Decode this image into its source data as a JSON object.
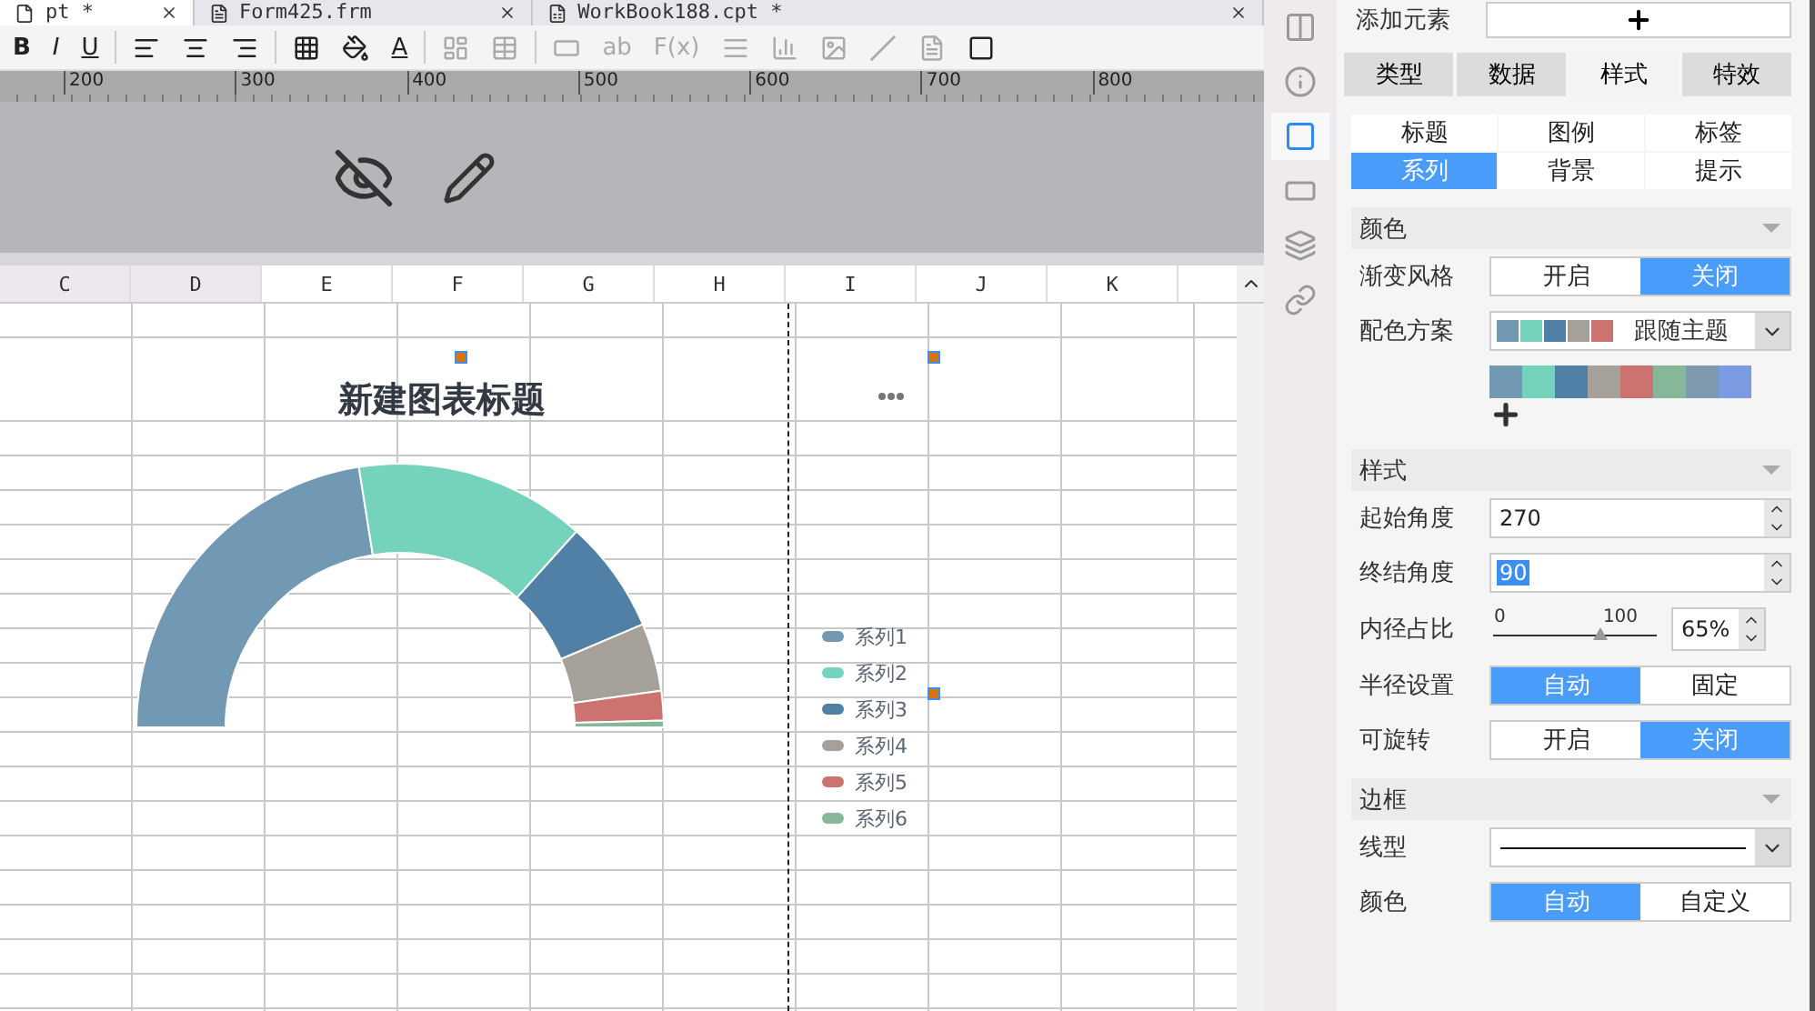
{
  "doc_tabs": [
    {
      "label": "pt *",
      "kind": "plain",
      "selected": true
    },
    {
      "label": "Form425.frm",
      "kind": "form",
      "selected": false
    },
    {
      "label": "WorkBook188.cpt *",
      "kind": "book",
      "selected": false
    }
  ],
  "toolbar": {
    "format_buttons": [
      "B",
      "I",
      "U"
    ],
    "font_color_button": "A",
    "text_tools": [
      "ab",
      "F(x)"
    ]
  },
  "ruler": {
    "ticks": [
      "200",
      "300",
      "400",
      "500",
      "600",
      "700",
      "800"
    ]
  },
  "sheet": {
    "columns": [
      {
        "label": "C",
        "selected": true
      },
      {
        "label": "D",
        "selected": true
      },
      {
        "label": "E",
        "selected": false
      },
      {
        "label": "F",
        "selected": false
      },
      {
        "label": "G",
        "selected": false
      },
      {
        "label": "H",
        "selected": false
      },
      {
        "label": "I",
        "selected": false
      },
      {
        "label": "J",
        "selected": false
      },
      {
        "label": "K",
        "selected": false
      }
    ]
  },
  "chart": {
    "title": "新建图表标题",
    "legend": [
      {
        "label": "系列1",
        "color": "#7299b3"
      },
      {
        "label": "系列2",
        "color": "#75d2bd"
      },
      {
        "label": "系列3",
        "color": "#5080a6"
      },
      {
        "label": "系列4",
        "color": "#a5a19a"
      },
      {
        "label": "系列5",
        "color": "#cc7370"
      },
      {
        "label": "系列6",
        "color": "#85b898"
      }
    ]
  },
  "sidebar": [
    {
      "selected": false
    },
    {
      "selected": false
    },
    {
      "selected": true
    },
    {
      "selected": false
    },
    {
      "selected": false
    },
    {
      "selected": false
    }
  ],
  "panel": {
    "add_element": "添加元素",
    "tabs": [
      {
        "label": "类型",
        "selected": false
      },
      {
        "label": "数据",
        "selected": false
      },
      {
        "label": "样式",
        "selected": true
      },
      {
        "label": "特效",
        "selected": false
      }
    ],
    "sub_tabs": [
      {
        "label": "标题",
        "selected": false
      },
      {
        "label": "图例",
        "selected": false
      },
      {
        "label": "标签",
        "selected": false
      },
      {
        "label": "系列",
        "selected": true
      },
      {
        "label": "背景",
        "selected": false
      },
      {
        "label": "提示",
        "selected": false
      }
    ],
    "rows": [
      {
        "kind": "header",
        "label": "颜色"
      },
      {
        "kind": "toggle",
        "label": "渐变风格",
        "options": [
          {
            "label": "开启",
            "selected": false
          },
          {
            "label": "关闭",
            "selected": true
          }
        ]
      },
      {
        "kind": "scheme",
        "label": "配色方案",
        "value": "跟随主题",
        "swatches": [
          {
            "color": "#7299b3"
          },
          {
            "color": "#75d2bd"
          },
          {
            "color": "#5080a6"
          },
          {
            "color": "#a5a19a"
          },
          {
            "color": "#cc7370"
          }
        ]
      },
      {
        "kind": "palette",
        "swatches": [
          {
            "color": "#7299b3"
          },
          {
            "color": "#75d2bd"
          },
          {
            "color": "#5080a6"
          },
          {
            "color": "#a5a19a"
          },
          {
            "color": "#cc7370"
          },
          {
            "color": "#85b898"
          },
          {
            "color": "#7e98ae"
          },
          {
            "color": "#7b9be3"
          }
        ]
      },
      {
        "kind": "header",
        "label": "样式"
      },
      {
        "kind": "number",
        "label": "起始角度",
        "value": "270",
        "highlighted": false
      },
      {
        "kind": "number",
        "label": "终结角度",
        "value": "90",
        "highlighted": true
      },
      {
        "kind": "slider",
        "label": "内径占比",
        "min": "0",
        "max": "100",
        "level": 0.65,
        "value": "65%"
      },
      {
        "kind": "toggle",
        "label": "半径设置",
        "options": [
          {
            "label": "自动",
            "selected": true
          },
          {
            "label": "固定",
            "selected": false
          }
        ]
      },
      {
        "kind": "toggle",
        "label": "可旋转",
        "options": [
          {
            "label": "开启",
            "selected": false
          },
          {
            "label": "关闭",
            "selected": true
          }
        ]
      },
      {
        "kind": "header",
        "label": "边框"
      },
      {
        "kind": "line",
        "label": "线型"
      },
      {
        "kind": "toggle",
        "label": "颜色",
        "options": [
          {
            "label": "自动",
            "selected": true
          },
          {
            "label": "自定义",
            "selected": false
          }
        ]
      }
    ]
  }
}
